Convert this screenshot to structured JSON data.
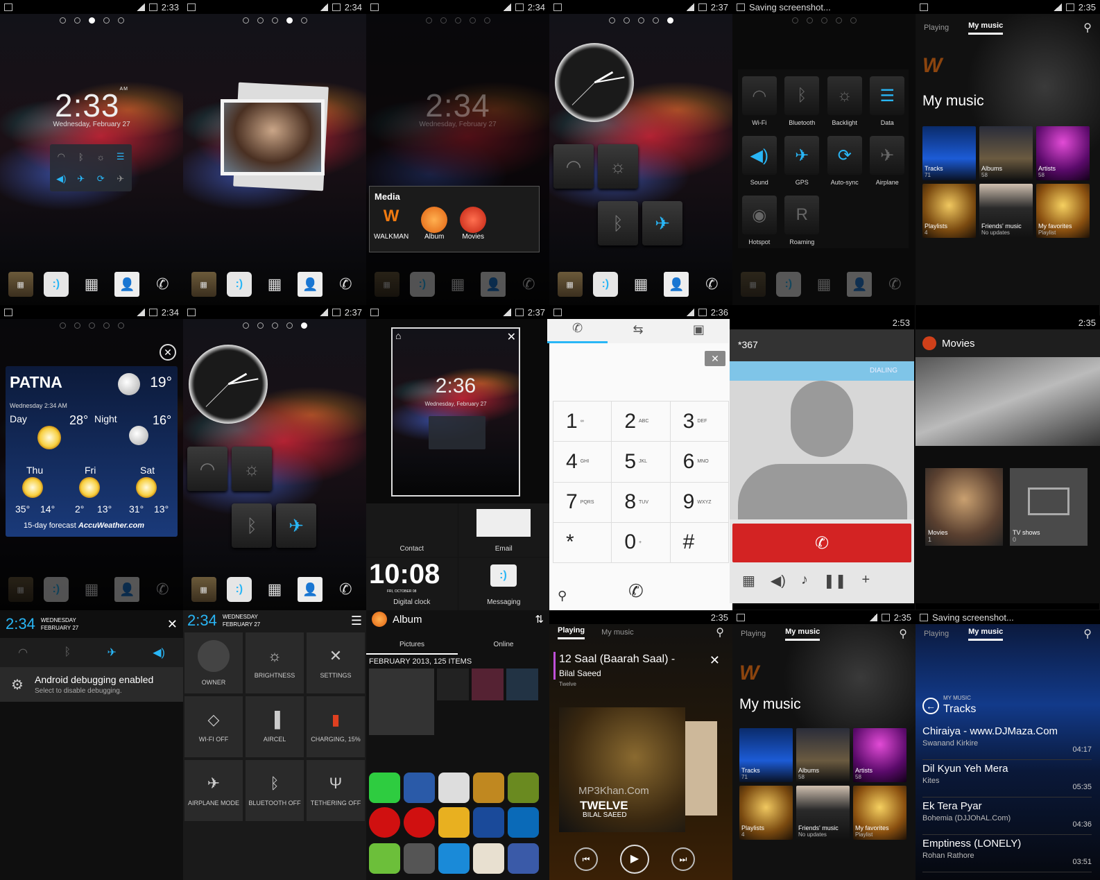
{
  "status_times": [
    "2:33",
    "2:34",
    "2:34",
    "2:37",
    "Saving screenshot...",
    "2:35",
    "2:34",
    "2:37",
    "2:37",
    "2:36",
    "2:53",
    "2:35",
    "2:35",
    "2:35",
    "Saving screenshot..."
  ],
  "lock": {
    "time": "2:33",
    "date": "Wednesday, February 27",
    "time_dim": "2:34",
    "date_dim": "Wednesday, February 27",
    "ampm": "AM"
  },
  "media_folder": {
    "title": "Media",
    "items": [
      "WALKMAN",
      "Album",
      "Movies"
    ]
  },
  "controls": [
    "Wi-Fi",
    "Bluetooth",
    "Backlight",
    "Data",
    "Sound",
    "GPS",
    "Auto-sync",
    "Airplane",
    "Hotspot",
    "Roaming"
  ],
  "music": {
    "tab_playing": "Playing",
    "tab_mymusic": "My music",
    "title": "My music",
    "tiles": [
      {
        "label": "Tracks",
        "sub": "71"
      },
      {
        "label": "Albums",
        "sub": "58"
      },
      {
        "label": "Artists",
        "sub": "58"
      },
      {
        "label": "Playlists",
        "sub": "4"
      },
      {
        "label": "Friends' music",
        "sub": "No updates"
      },
      {
        "label": "My favorites",
        "sub": "Playlist"
      }
    ]
  },
  "weather": {
    "city": "PATNA",
    "temp": "19°",
    "date": "Wednesday 2:34 AM",
    "day_label": "Day",
    "day_temp": "28°",
    "night_label": "Night",
    "night_temp": "16°",
    "days": [
      {
        "d": "Thu",
        "hi": "35°",
        "lo": "14°"
      },
      {
        "d": "Fri",
        "hi": "2°",
        "lo": "13°"
      },
      {
        "d": "Sat",
        "hi": "31°",
        "lo": "13°"
      }
    ],
    "forecast": "15-day forecast",
    "brand": "AccuWeather.com"
  },
  "edit": {
    "time": "2:36",
    "date": "Wednesday, February 27",
    "contact": "Contact",
    "email": "Email",
    "digital": "10:08",
    "digital_date": "FRI, OCTOBER 08",
    "digital_label": "Digital clock",
    "messaging": "Messaging"
  },
  "dialer": {
    "keys": [
      {
        "n": "1",
        "l": "∞"
      },
      {
        "n": "2",
        "l": "ABC"
      },
      {
        "n": "3",
        "l": "DEF"
      },
      {
        "n": "4",
        "l": "GHI"
      },
      {
        "n": "5",
        "l": "JKL"
      },
      {
        "n": "6",
        "l": "MNO"
      },
      {
        "n": "7",
        "l": "PQRS"
      },
      {
        "n": "8",
        "l": "TUV"
      },
      {
        "n": "9",
        "l": "WXYZ"
      },
      {
        "n": "*",
        "l": ""
      },
      {
        "n": "0",
        "l": "+"
      },
      {
        "n": "#",
        "l": ""
      }
    ]
  },
  "call": {
    "number": "*367",
    "status": "DIALING"
  },
  "movies": {
    "title": "Movies",
    "tiles": [
      {
        "label": "Movies",
        "sub": "1"
      },
      {
        "label": "TV shows",
        "sub": "0"
      }
    ]
  },
  "notif": {
    "time": "2:34",
    "day": "WEDNESDAY",
    "date": "FEBRUARY 27",
    "title": "Android debugging enabled",
    "sub": "Select to disable debugging."
  },
  "toggles": {
    "time": "2:34",
    "day": "WEDNESDAY",
    "date": "FEBRUARY 27",
    "items": [
      "OWNER",
      "BRIGHTNESS",
      "SETTINGS",
      "WI-FI OFF",
      "AIRCEL",
      "CHARGING, 15%",
      "AIRPLANE MODE",
      "BLUETOOTH OFF",
      "TETHERING OFF"
    ]
  },
  "album": {
    "title": "Album",
    "tab1": "Pictures",
    "tab2": "Online",
    "header": "FEBRUARY 2013, 125 ITEMS"
  },
  "player": {
    "tab_playing": "Playing",
    "tab_mymusic": "My music",
    "song": "12 Saal (Baarah Saal) -",
    "artist": "Bilal Saeed",
    "album": "Twelve",
    "art_text": "TWELVE",
    "art_sub": "BILAL SAEED",
    "watermark": "MP3Khan.Com"
  },
  "tracklist": {
    "crumb": "MY MUSIC",
    "title": "Tracks",
    "items": [
      {
        "n": "Chiraiya - www.DJMaza.Com",
        "a": "Swanand Kirkire",
        "d": "04:17"
      },
      {
        "n": "Dil Kyun Yeh Mera",
        "a": "Kites",
        "d": "05:35"
      },
      {
        "n": "Ek Tera Pyar",
        "a": "Bohemia (DJJOhAL.Com)",
        "d": "04:36"
      },
      {
        "n": "Emptiness (LONELY)",
        "a": "Rohan Rathore",
        "d": "03:51"
      }
    ]
  }
}
